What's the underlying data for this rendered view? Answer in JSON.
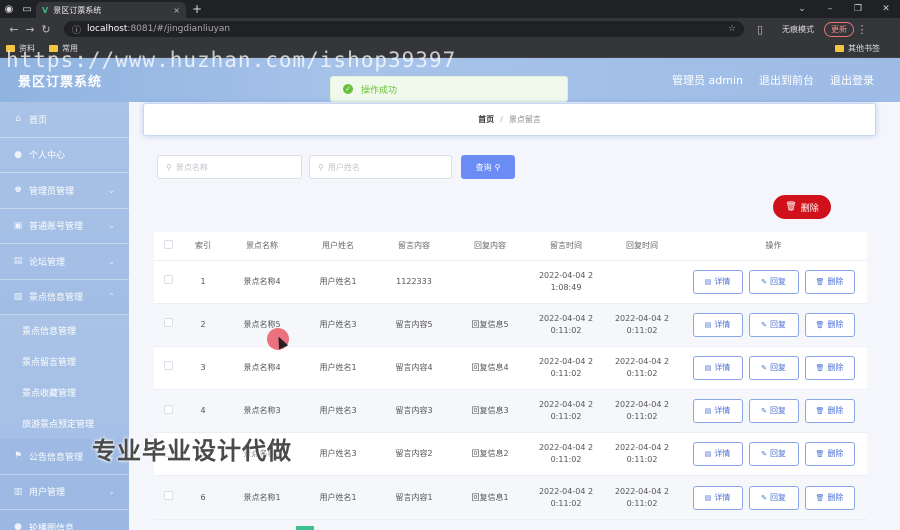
{
  "browser": {
    "tab_title": "景区订票系统",
    "url_host": "localhost",
    "url_rest": ":8081/#/jingdianliuyan",
    "incognito_label": "无痕模式",
    "update_label": "更新",
    "bookmarks": [
      "资料",
      "常用"
    ],
    "bookmark_right": "其他书签"
  },
  "watermark": "https://www.huzhan.com/ishop39397",
  "header": {
    "title": "景区订票系统",
    "user": "管理员 admin",
    "back_front": "退出到前台",
    "logout": "退出登录"
  },
  "toast": {
    "text": "操作成功"
  },
  "sidebar": {
    "items": [
      {
        "label": "首页",
        "icon": "home-icon"
      },
      {
        "label": "个人中心",
        "icon": "user-icon"
      },
      {
        "label": "管理员管理",
        "icon": "users-icon"
      },
      {
        "label": "普通账号管理",
        "icon": "id-card-icon"
      },
      {
        "label": "论坛管理",
        "icon": "forum-icon"
      },
      {
        "label": "景点信息管理",
        "icon": "scenic-icon"
      }
    ],
    "submenu": [
      "景点信息管理",
      "景点留言管理",
      "景点收藏管理",
      "旅游景点预定管理"
    ],
    "items_after": [
      {
        "label": "公告信息管理",
        "icon": "notice-icon"
      },
      {
        "label": "用户管理",
        "icon": "user-manage-icon"
      },
      {
        "label": "轮播图信息",
        "icon": "carousel-icon"
      }
    ]
  },
  "breadcrumb": {
    "home": "首页",
    "sep": "/",
    "current": "景点留言"
  },
  "search": {
    "spot_placeholder": "景点名称",
    "user_placeholder": "用户姓名",
    "query_label": "查询",
    "delete_label": "删除"
  },
  "table": {
    "headers": [
      "索引",
      "景点名称",
      "用户姓名",
      "留言内容",
      "回复内容",
      "留言时间",
      "回复时间",
      "操作"
    ],
    "rows": [
      {
        "idx": "1",
        "spot": "景点名称4",
        "user": "用户姓名1",
        "content": "1122333",
        "reply": "",
        "time": "2022-04-04 2\n1:08:49",
        "rtime": ""
      },
      {
        "idx": "2",
        "spot": "景点名称5",
        "user": "用户姓名3",
        "content": "留言内容5",
        "reply": "回复信息5",
        "time": "2022-04-04 2\n0:11:02",
        "rtime": "2022-04-04 2\n0:11:02"
      },
      {
        "idx": "3",
        "spot": "景点名称4",
        "user": "用户姓名1",
        "content": "留言内容4",
        "reply": "回复信息4",
        "time": "2022-04-04 2\n0:11:02",
        "rtime": "2022-04-04 2\n0:11:02"
      },
      {
        "idx": "4",
        "spot": "景点名称3",
        "user": "用户姓名3",
        "content": "留言内容3",
        "reply": "回复信息3",
        "time": "2022-04-04 2\n0:11:02",
        "rtime": "2022-04-04 2\n0:11:02"
      },
      {
        "idx": "5",
        "spot": "景点名称2",
        "user": "用户姓名3",
        "content": "留言内容2",
        "reply": "回复信息2",
        "time": "2022-04-04 2\n0:11:02",
        "rtime": "2022-04-04 2\n0:11:02"
      },
      {
        "idx": "6",
        "spot": "景点名称1",
        "user": "用户姓名1",
        "content": "留言内容1",
        "reply": "回复信息1",
        "time": "2022-04-04 2\n0:11:02",
        "rtime": "2022-04-04 2\n0:11:02"
      }
    ],
    "ops": {
      "detail": "详情",
      "reply": "回复",
      "delete": "删除"
    }
  },
  "overlay": "专业毕业设计代做",
  "colors": {
    "accent": "#6c8cf5",
    "danger": "#d0111b",
    "sidebar": "#a9c2e6",
    "success": "#67c23a"
  }
}
